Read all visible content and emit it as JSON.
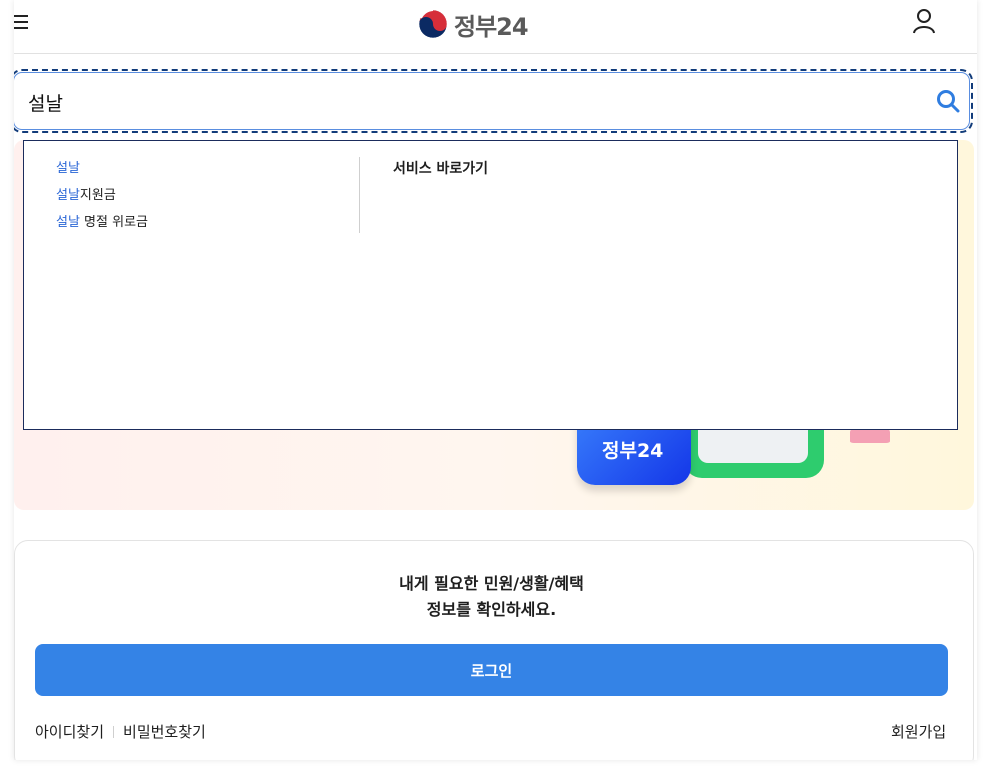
{
  "header": {
    "logo_text": "정부24",
    "menu_icon": "hamburger-menu-icon",
    "user_icon": "user-icon"
  },
  "search": {
    "value": "설날",
    "icon": "search-icon"
  },
  "autocomplete": {
    "suggestions": [
      {
        "highlight": "설날",
        "rest": ""
      },
      {
        "highlight": "설날",
        "rest": "지원금"
      },
      {
        "highlight": "설날",
        "rest": " 명절 위로금"
      }
    ],
    "quick_service_title": "서비스 바로가기"
  },
  "banner": {
    "app_label": "정부24"
  },
  "login": {
    "message_line1": "내게 필요한 민원/생활/혜택",
    "message_line2": "정보를 확인하세요.",
    "button_label": "로그인",
    "find_id": "아이디찾기",
    "find_password": "비밀번호찾기",
    "signup": "회원가입"
  },
  "colors": {
    "accent": "#3483e6",
    "highlight": "#2a66d6",
    "focus_border": "#123c7a"
  }
}
